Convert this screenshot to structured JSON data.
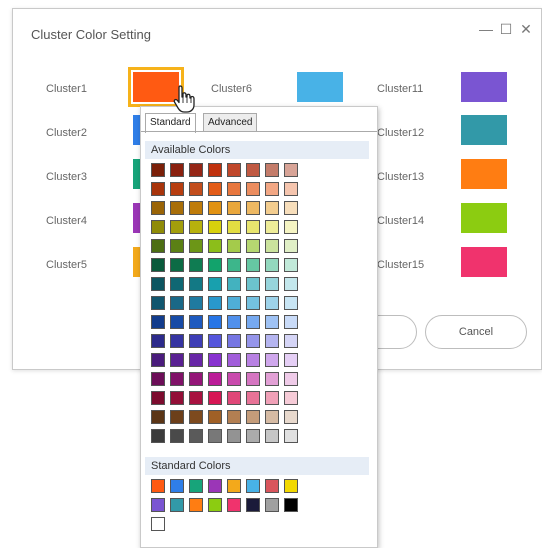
{
  "dialog": {
    "title": "Cluster Color Setting",
    "minimize_glyph": "—",
    "maximize_glyph": "☐",
    "close_glyph": "✕",
    "cancel_label": "Cancel"
  },
  "clusters_left": [
    {
      "label": "Cluster1",
      "color": "#ff5a12"
    },
    {
      "label": "Cluster2",
      "color": "#2f7ee8"
    },
    {
      "label": "Cluster3",
      "color": "#17a47a"
    },
    {
      "label": "Cluster4",
      "color": "#9b36b7"
    },
    {
      "label": "Cluster5",
      "color": "#f3a91b"
    }
  ],
  "clusters_mid": [
    {
      "label": "Cluster6",
      "color": "#48b2e7"
    }
  ],
  "clusters_right": [
    {
      "label": "Cluster11",
      "color": "#7a55d2"
    },
    {
      "label": "Cluster12",
      "color": "#3299a8"
    },
    {
      "label": "Cluster13",
      "color": "#ff7d12"
    },
    {
      "label": "Cluster14",
      "color": "#8ccc11"
    },
    {
      "label": "Cluster15",
      "color": "#f0336d"
    }
  ],
  "popup": {
    "tabs": [
      "Standard",
      "Advanced"
    ],
    "available_label": "Available Colors",
    "standard_label": "Standard Colors"
  },
  "available_colors": [
    [
      "#7a1f08",
      "#8a200e",
      "#952616",
      "#c0310d",
      "#c0472a",
      "#c05942",
      "#c47c6a",
      "#d8a497"
    ],
    [
      "#a8340b",
      "#b73e10",
      "#c24d1c",
      "#e35c18",
      "#e8773e",
      "#ec8d5f",
      "#f2a784",
      "#f5c5ae"
    ],
    [
      "#9a6406",
      "#a86e09",
      "#bf7c0a",
      "#e19212",
      "#e9a73c",
      "#eeb963",
      "#f3cd8f",
      "#f7debb"
    ],
    [
      "#8f8b07",
      "#a39e0c",
      "#b7b10d",
      "#d8d10c",
      "#e2dd42",
      "#e8e56e",
      "#eeec98",
      "#f5f4c3"
    ],
    [
      "#4d6e14",
      "#5b8015",
      "#6c9617",
      "#8cbe1a",
      "#a4cb4b",
      "#b6d771",
      "#cbe39d",
      "#e0efc6"
    ],
    [
      "#0a5a3b",
      "#0c6b45",
      "#0f7c52",
      "#12a36c",
      "#3db68b",
      "#66c7a3",
      "#93d8be",
      "#c1e9d9"
    ],
    [
      "#0c5560",
      "#0f6773",
      "#137985",
      "#18a0ae",
      "#43b2bf",
      "#6cc3cd",
      "#97d5dc",
      "#c3e7ec"
    ],
    [
      "#11566e",
      "#1a6887",
      "#1f7aa0",
      "#2998cc",
      "#4faed8",
      "#74c1e0",
      "#9ed3ea",
      "#c8e5f4"
    ],
    [
      "#123c8c",
      "#184ba6",
      "#1e5abf",
      "#2775e6",
      "#5090ec",
      "#76a9f0",
      "#9fc2f4",
      "#c9dbf8"
    ],
    [
      "#2c2a8a",
      "#3534a1",
      "#3e3eb6",
      "#5556dc",
      "#7676e3",
      "#9595ea",
      "#b5b5f0",
      "#d5d5f6"
    ],
    [
      "#4a1c7c",
      "#592192",
      "#6826a7",
      "#8832d0",
      "#a15dda",
      "#b881e3",
      "#cfa7ec",
      "#e5cff5"
    ],
    [
      "#6c0e58",
      "#801268",
      "#941678",
      "#bb1c98",
      "#c94aad",
      "#d575c1",
      "#e2a0d5",
      "#efcbe8"
    ],
    [
      "#7c0c2e",
      "#920f37",
      "#a81240",
      "#d61654",
      "#e04778",
      "#e87397",
      "#f0a0b7",
      "#f6cbd7"
    ],
    [
      "#5b3516",
      "#6c3f1a",
      "#7d4a1e",
      "#a06026",
      "#b37f52",
      "#c49c7a",
      "#d6bba4",
      "#e8d9cd"
    ],
    [
      "#3b3b3b",
      "#4a4a4a",
      "#5a5a5a",
      "#787878",
      "#939393",
      "#ababab",
      "#c6c6c6",
      "#e0e0e0"
    ]
  ],
  "standard_colors": [
    [
      "#ff5a12",
      "#2f7ee8",
      "#17a47a",
      "#9b36b7",
      "#f3a91b",
      "#48b2e7",
      "#d9555c",
      "#f2d800"
    ],
    [
      "#7a55d2",
      "#3299a8",
      "#ff7d12",
      "#8ccc11",
      "#f0336d",
      "#1b1b3a",
      "#a0a0a0",
      "#000000"
    ],
    [
      "#ffffff"
    ]
  ]
}
